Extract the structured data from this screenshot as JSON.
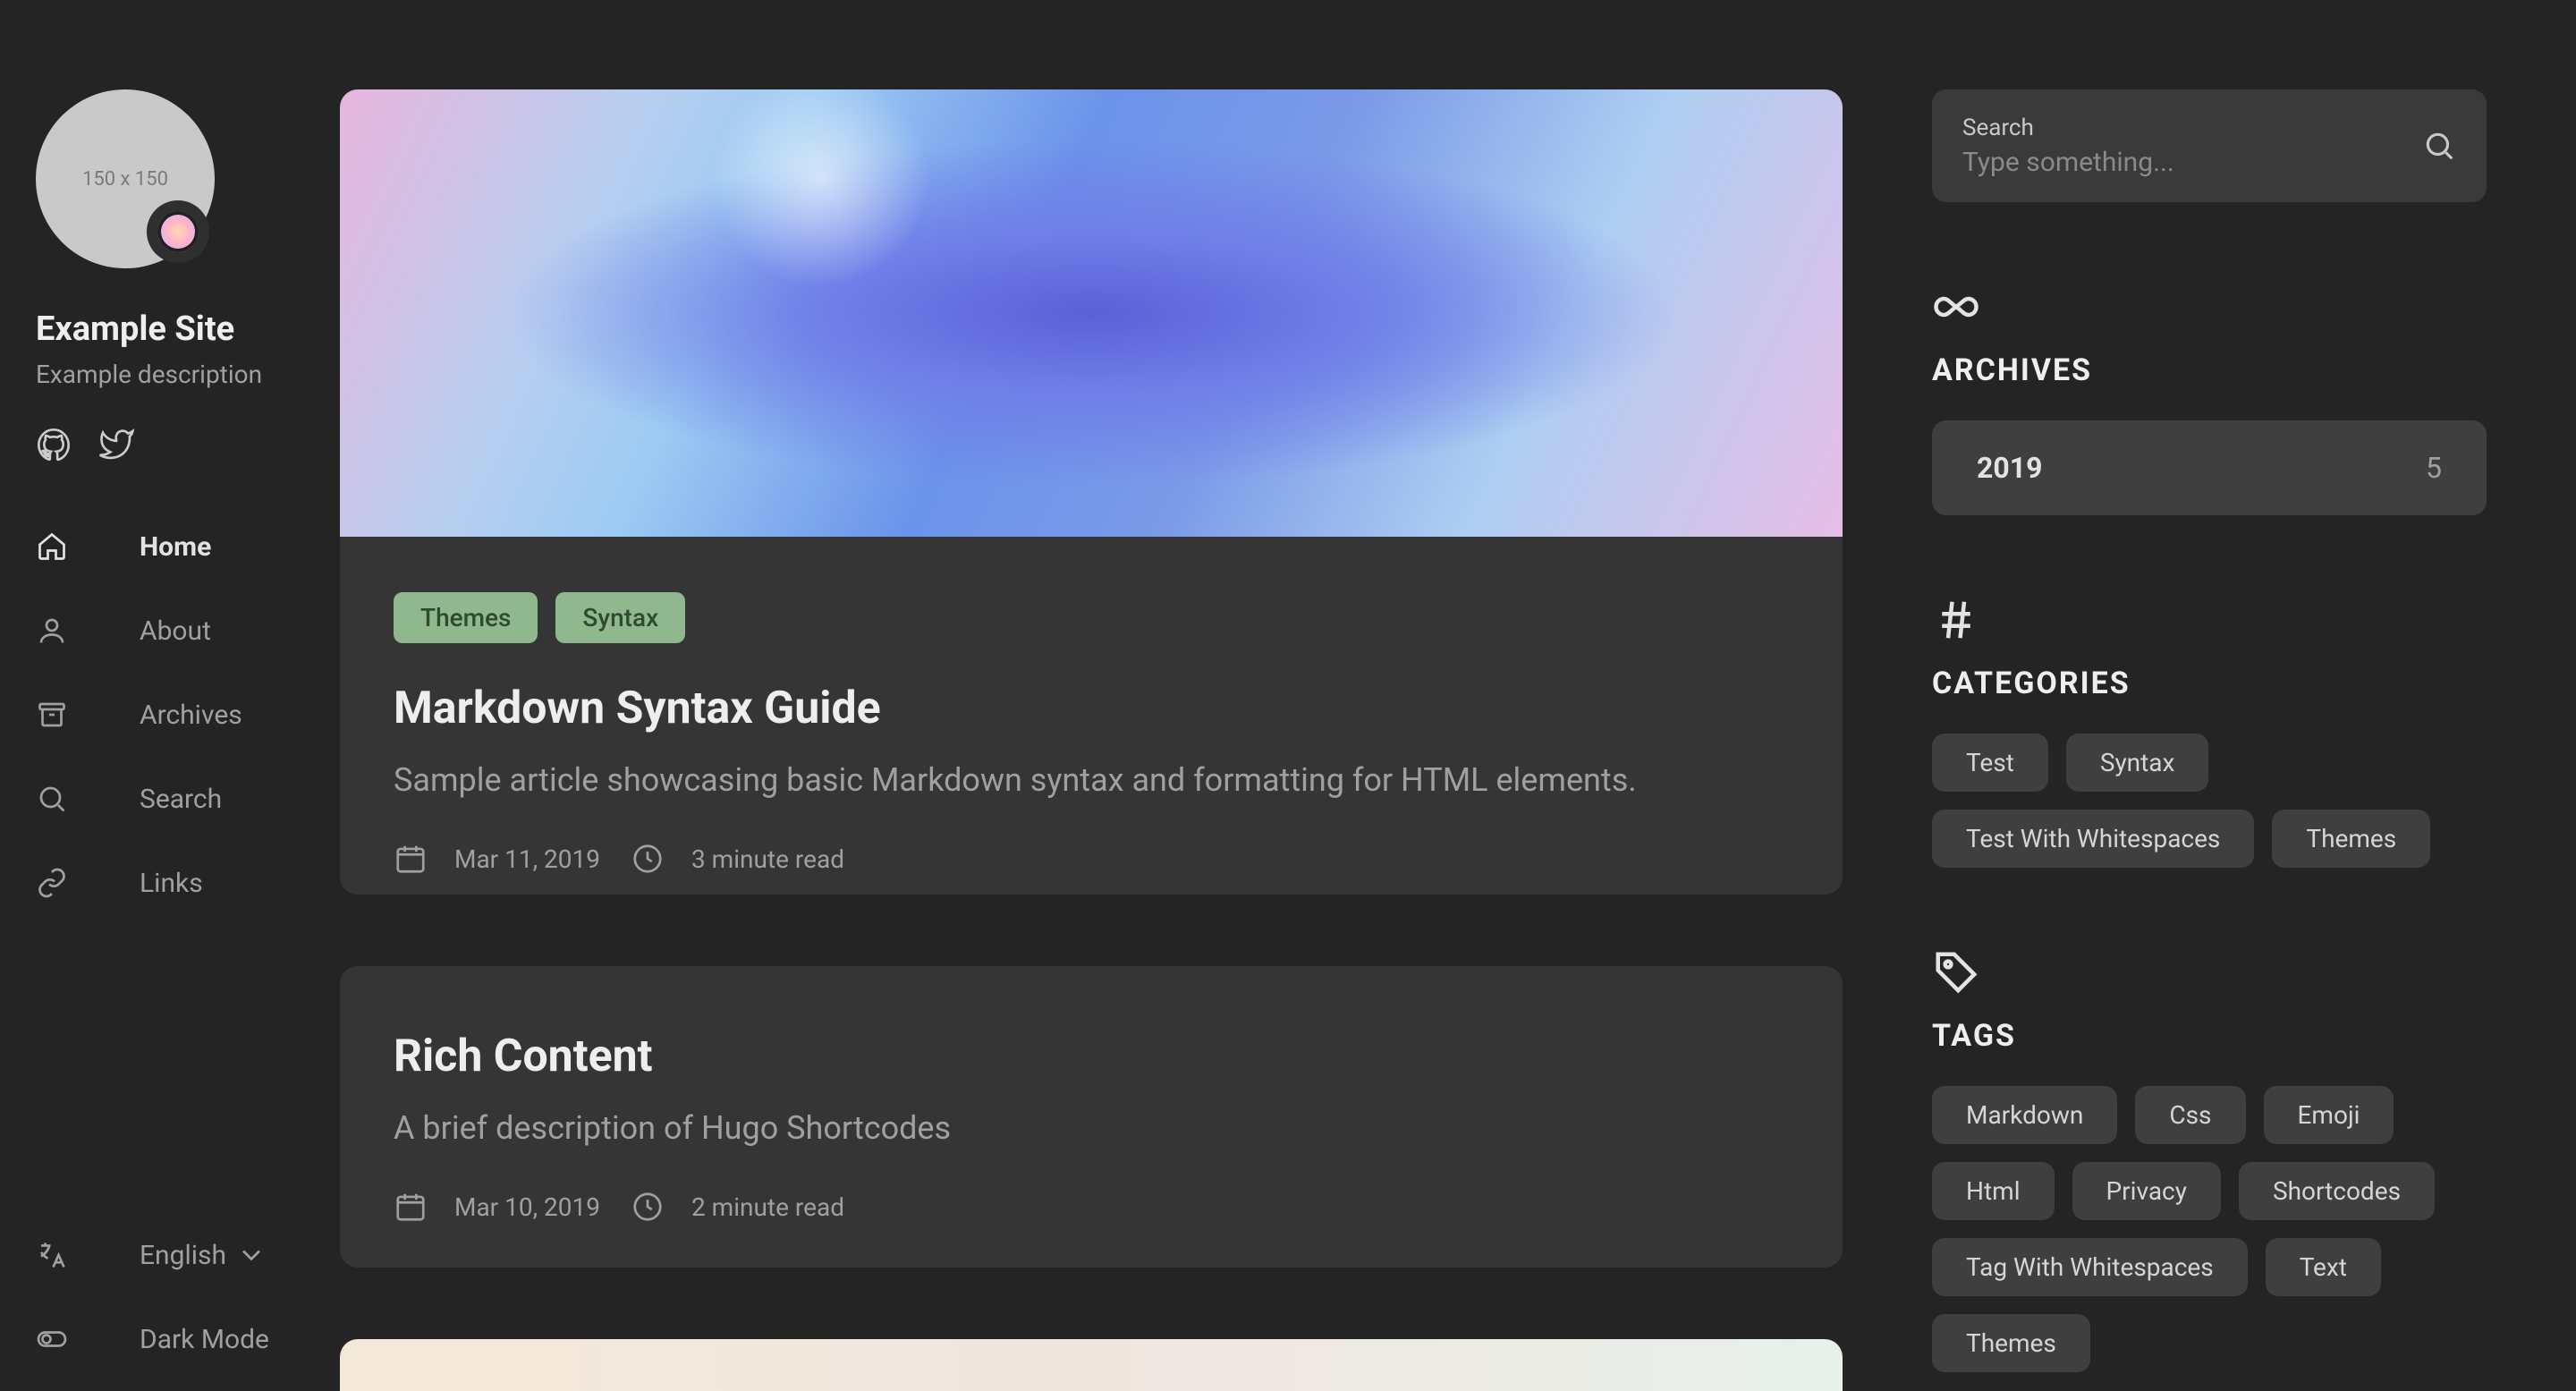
{
  "site": {
    "avatar_text": "150 x 150",
    "title": "Example Site",
    "description": "Example description"
  },
  "nav": {
    "home": "Home",
    "about": "About",
    "archives": "Archives",
    "search": "Search",
    "links": "Links"
  },
  "footer": {
    "language": "English",
    "dark_mode": "Dark Mode"
  },
  "posts": [
    {
      "tags": [
        "Themes",
        "Syntax"
      ],
      "title": "Markdown Syntax Guide",
      "subtitle": "Sample article showcasing basic Markdown syntax and formatting for HTML elements.",
      "date": "Mar 11, 2019",
      "read_time": "3 minute read"
    },
    {
      "tags": [],
      "title": "Rich Content",
      "subtitle": "A brief description of Hugo Shortcodes",
      "date": "Mar 10, 2019",
      "read_time": "2 minute read"
    }
  ],
  "search": {
    "label": "Search",
    "placeholder": "Type something..."
  },
  "archives": {
    "heading": "ARCHIVES",
    "items": [
      {
        "year": "2019",
        "count": "5"
      }
    ]
  },
  "categories": {
    "heading": "CATEGORIES",
    "items": [
      "Test",
      "Syntax",
      "Test With Whitespaces",
      "Themes"
    ]
  },
  "tags": {
    "heading": "TAGS",
    "items": [
      "Markdown",
      "Css",
      "Emoji",
      "Html",
      "Privacy",
      "Shortcodes",
      "Tag With Whitespaces",
      "Text",
      "Themes"
    ]
  }
}
